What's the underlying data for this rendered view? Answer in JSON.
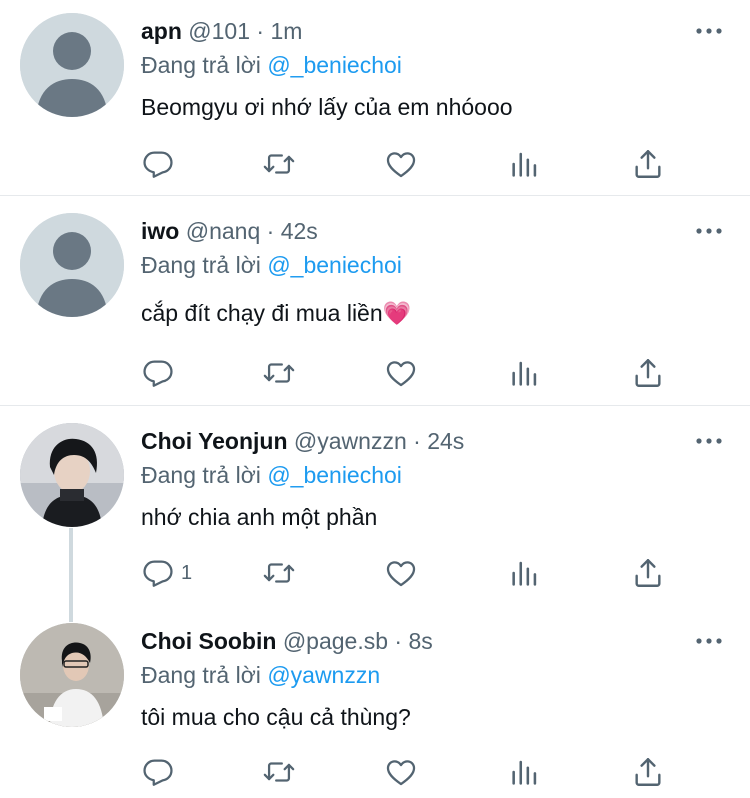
{
  "tweets": [
    {
      "name": "apn",
      "handle": "@101",
      "dot": "·",
      "time": "1m",
      "replying_prefix": "Đang trả lời ",
      "replying_to": "@_beniechoi",
      "text": "Beomgyu ơi nhớ lấy của em nhóooo",
      "reply_count": ""
    },
    {
      "name": "iwo",
      "handle": "@nanq",
      "dot": "·",
      "time": "42s",
      "replying_prefix": "Đang trả lời ",
      "replying_to": "@_beniechoi",
      "text": "cắp đít chạy đi mua liền💗",
      "reply_count": ""
    },
    {
      "name": "Choi Yeonjun",
      "handle": "@yawnzzn",
      "dot": "·",
      "time": "24s",
      "replying_prefix": "Đang trả lời ",
      "replying_to": "@_beniechoi",
      "text": "nhớ chia anh một phần",
      "reply_count": "1"
    },
    {
      "name": "Choi Soobin",
      "handle": "@page.sb",
      "dot": "·",
      "time": "8s",
      "replying_prefix": "Đang trả lời ",
      "replying_to": "@yawnzzn",
      "text": "tôi mua cho cậu cả thùng?",
      "reply_count": ""
    }
  ],
  "icons": {
    "reply": "reply-icon",
    "retweet": "retweet-icon",
    "like": "heart-icon",
    "stats": "stats-icon",
    "share": "share-icon",
    "more": "more-icon"
  },
  "colors": {
    "text": "#0f1419",
    "secondary": "#536471",
    "mention": "#1d9bf0",
    "divider": "#e6e9ec",
    "avatar_default": "#cfd9de"
  }
}
